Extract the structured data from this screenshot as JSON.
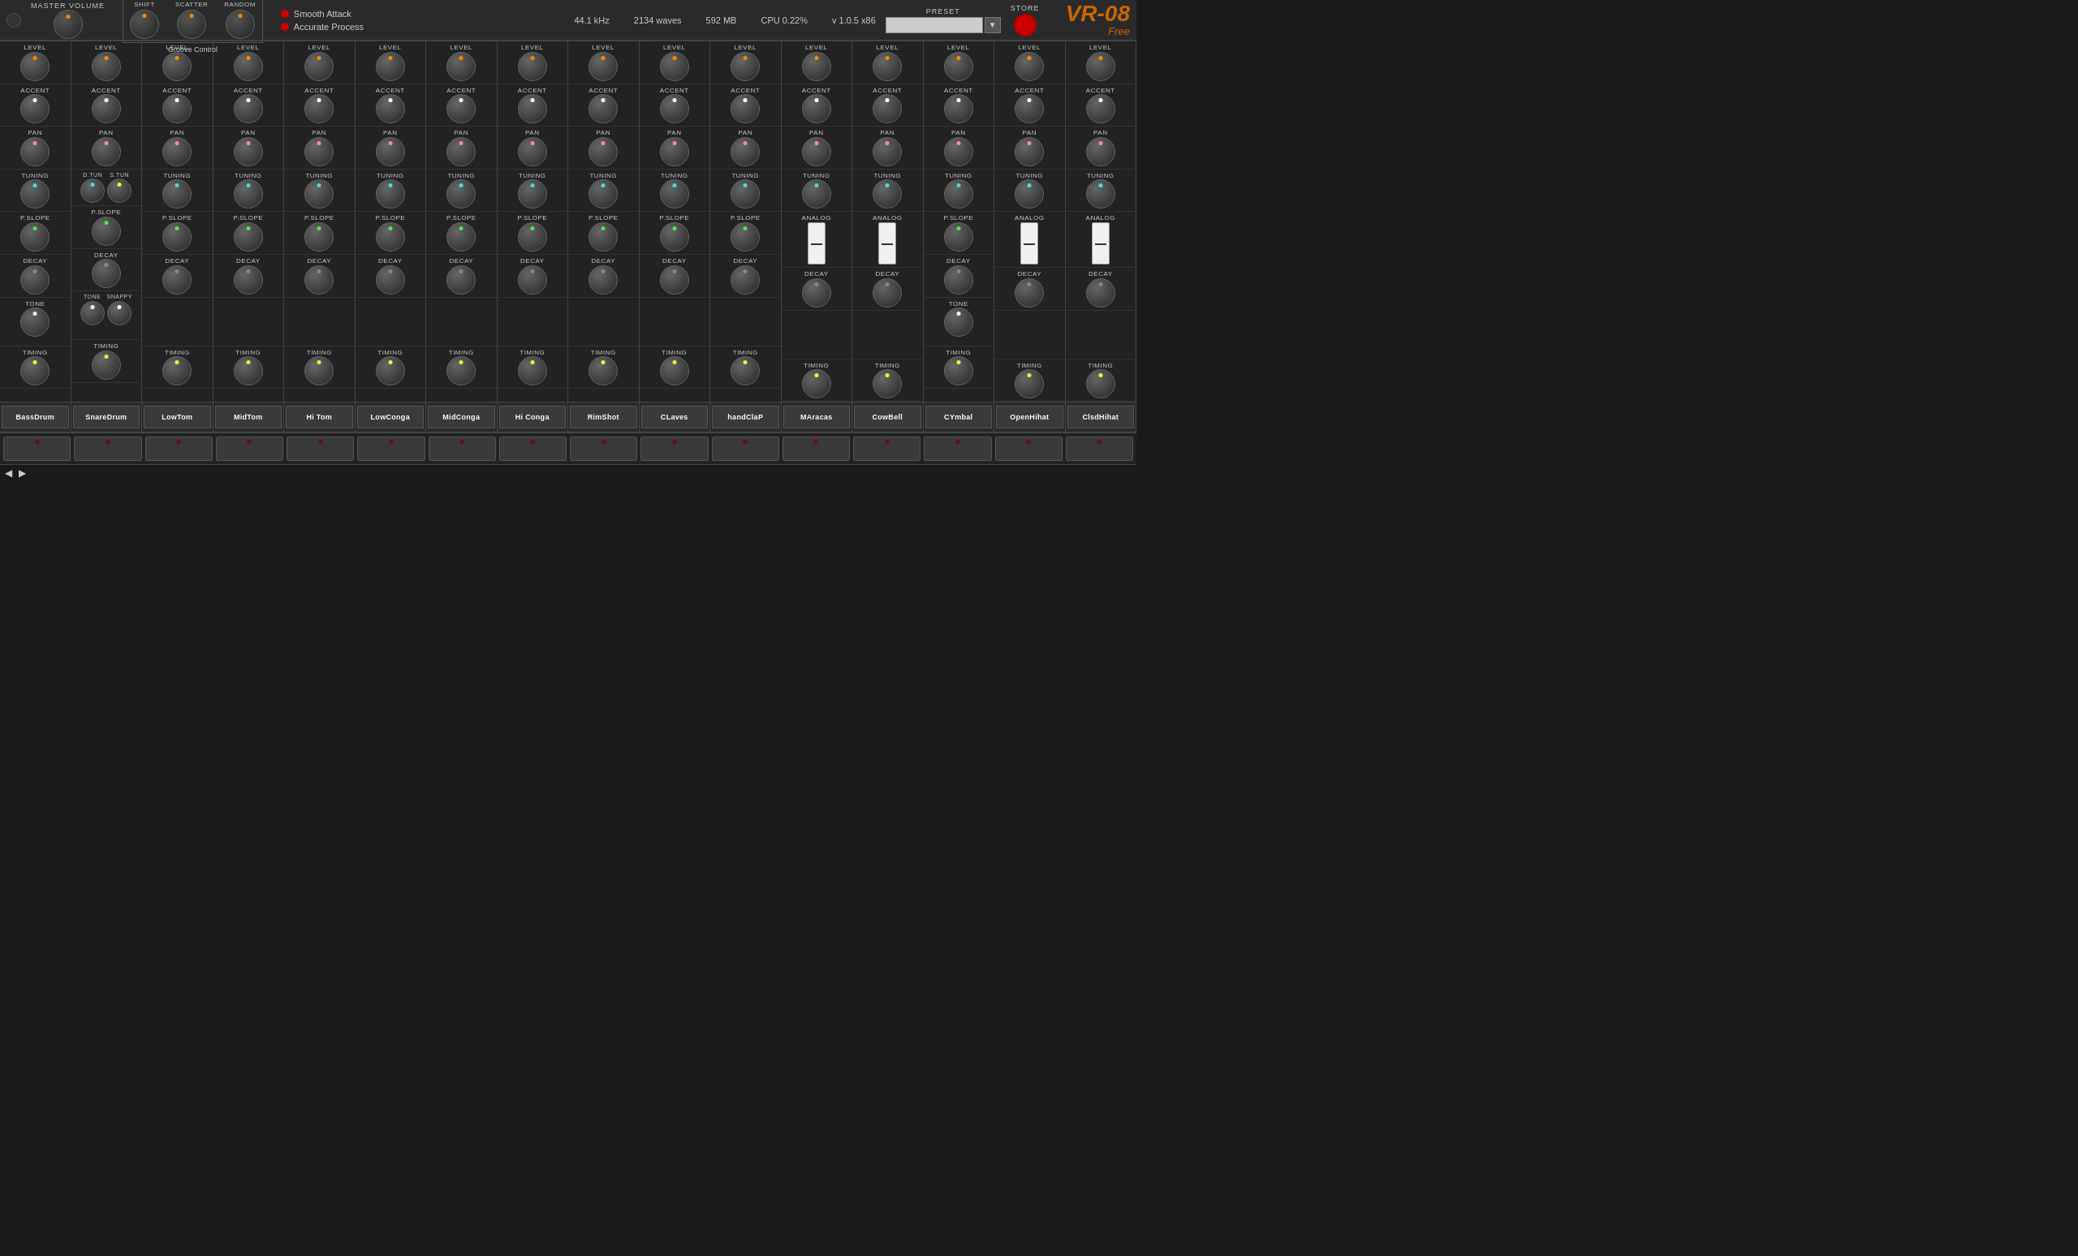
{
  "app": {
    "brand": "VR-08",
    "brand_sub": "Free",
    "status": {
      "sample_rate": "44.1 kHz",
      "waves": "2134 waves",
      "memory": "592 MB",
      "cpu": "CPU  0.22%",
      "version": "v 1.0.5 x86"
    },
    "preset_label": "PRESET",
    "store_label": "STORE"
  },
  "top_controls": {
    "master_volume_label": "MASTER VOLUME",
    "groove_label": "Groove Control",
    "shift_label": "SHIFT",
    "scatter_label": "SCATTER",
    "random_label": "RANDOM",
    "smooth_attack": "Smooth Attack",
    "accurate_process": "Accurate Process"
  },
  "channels": [
    {
      "name": "BassDrum",
      "sections": [
        "LEVEL",
        "ACCENT",
        "PAN",
        "TUNING",
        "P.SLOPE",
        "DECAY",
        "TONE",
        "TIMING"
      ],
      "knob_colors": [
        "orange",
        "white",
        "pink",
        "cyan",
        "green",
        "black",
        "white",
        "yellow"
      ],
      "has_analog": false
    },
    {
      "name": "SnareDrum",
      "sections": [
        "LEVEL",
        "ACCENT",
        "PAN",
        "D.TUN / S.TUN",
        "P.SLOPE",
        "DECAY",
        "TONE / SNAPPY",
        "TIMING"
      ],
      "knob_colors": [
        "orange",
        "white",
        "pink",
        "cyan",
        "green",
        "black",
        "white",
        "yellow"
      ],
      "has_analog": false
    },
    {
      "name": "LowTom",
      "sections": [
        "LEVEL",
        "ACCENT",
        "PAN",
        "TUNING",
        "P.SLOPE",
        "DECAY",
        "",
        "TIMING"
      ],
      "knob_colors": [
        "orange",
        "white",
        "pink",
        "cyan",
        "green",
        "black",
        "",
        "yellow"
      ],
      "has_analog": false
    },
    {
      "name": "MidTom",
      "sections": [
        "LEVEL",
        "ACCENT",
        "PAN",
        "TUNING",
        "P.SLOPE",
        "DECAY",
        "",
        "TIMING"
      ],
      "knob_colors": [
        "orange",
        "white",
        "pink",
        "cyan",
        "green",
        "black",
        "",
        "yellow"
      ],
      "has_analog": false
    },
    {
      "name": "Hi Tom",
      "sections": [
        "LEVEL",
        "ACCENT",
        "PAN",
        "TUNING",
        "P.SLOPE",
        "DECAY",
        "",
        "TIMING"
      ],
      "knob_colors": [
        "orange",
        "white",
        "pink",
        "cyan",
        "green",
        "black",
        "",
        "yellow"
      ],
      "has_analog": false
    },
    {
      "name": "LowConga",
      "sections": [
        "LEVEL",
        "ACCENT",
        "PAN",
        "TUNING",
        "P.SLOPE",
        "DECAY",
        "",
        "TIMING"
      ],
      "knob_colors": [
        "orange",
        "white",
        "pink",
        "cyan",
        "green",
        "black",
        "",
        "yellow"
      ],
      "has_analog": false
    },
    {
      "name": "MidConga",
      "sections": [
        "LEVEL",
        "ACCENT",
        "PAN",
        "TUNING",
        "P.SLOPE",
        "DECAY",
        "",
        "TIMING"
      ],
      "knob_colors": [
        "orange",
        "white",
        "pink",
        "cyan",
        "green",
        "black",
        "",
        "yellow"
      ],
      "has_analog": false
    },
    {
      "name": "Hi Conga",
      "sections": [
        "LEVEL",
        "ACCENT",
        "PAN",
        "TUNING",
        "P.SLOPE",
        "DECAY",
        "",
        "TIMING"
      ],
      "knob_colors": [
        "orange",
        "white",
        "pink",
        "cyan",
        "green",
        "black",
        "",
        "yellow"
      ],
      "has_analog": false
    },
    {
      "name": "RimShot",
      "sections": [
        "LEVEL",
        "ACCENT",
        "PAN",
        "TUNING",
        "P.SLOPE",
        "DECAY",
        "",
        "TIMING"
      ],
      "knob_colors": [
        "orange",
        "white",
        "pink",
        "cyan",
        "green",
        "black",
        "",
        "yellow"
      ],
      "has_analog": false
    },
    {
      "name": "CLaves",
      "sections": [
        "LEVEL",
        "ACCENT",
        "PAN",
        "TUNING",
        "P.SLOPE",
        "DECAY",
        "",
        "TIMING"
      ],
      "knob_colors": [
        "orange",
        "white",
        "pink",
        "cyan",
        "green",
        "black",
        "",
        "yellow"
      ],
      "has_analog": false
    },
    {
      "name": "handClaP",
      "sections": [
        "LEVEL",
        "ACCENT",
        "PAN",
        "TUNING",
        "P.SLOPE",
        "DECAY",
        "",
        "TIMING"
      ],
      "knob_colors": [
        "orange",
        "white",
        "pink",
        "cyan",
        "green",
        "black",
        "",
        "yellow"
      ],
      "has_analog": false
    },
    {
      "name": "MAracas",
      "sections": [
        "LEVEL",
        "ACCENT",
        "PAN",
        "TUNING",
        "ANALOG",
        "DECAY",
        "",
        "TIMING"
      ],
      "knob_colors": [
        "orange",
        "white",
        "pink",
        "cyan",
        "analog",
        "black",
        "",
        "yellow"
      ],
      "has_analog": true
    },
    {
      "name": "CowBell",
      "sections": [
        "LEVEL",
        "ACCENT",
        "PAN",
        "TUNING",
        "ANALOG",
        "DECAY",
        "",
        "TIMING"
      ],
      "knob_colors": [
        "orange",
        "white",
        "pink",
        "cyan",
        "analog",
        "black",
        "",
        "yellow"
      ],
      "has_analog": true
    },
    {
      "name": "CYmbal",
      "sections": [
        "LEVEL",
        "ACCENT",
        "PAN",
        "TUNING",
        "P.SLOPE",
        "DECAY",
        "TONE",
        "TIMING"
      ],
      "knob_colors": [
        "orange",
        "white",
        "pink",
        "cyan",
        "green",
        "black",
        "white",
        "yellow"
      ],
      "has_analog": false
    },
    {
      "name": "OpenHihat",
      "sections": [
        "LEVEL",
        "ACCENT",
        "PAN",
        "TUNING",
        "ANALOG",
        "DECAY",
        "",
        "TIMING"
      ],
      "knob_colors": [
        "orange",
        "white",
        "pink",
        "cyan",
        "analog",
        "black",
        "",
        "yellow"
      ],
      "has_analog": true
    },
    {
      "name": "ClsdHihat",
      "sections": [
        "LEVEL",
        "ACCENT",
        "PAN",
        "TUNING",
        "ANALOG",
        "DECAY",
        "",
        "TIMING"
      ],
      "knob_colors": [
        "orange",
        "white",
        "pink",
        "cyan",
        "analog",
        "black",
        "",
        "yellow"
      ],
      "has_analog": true
    }
  ]
}
